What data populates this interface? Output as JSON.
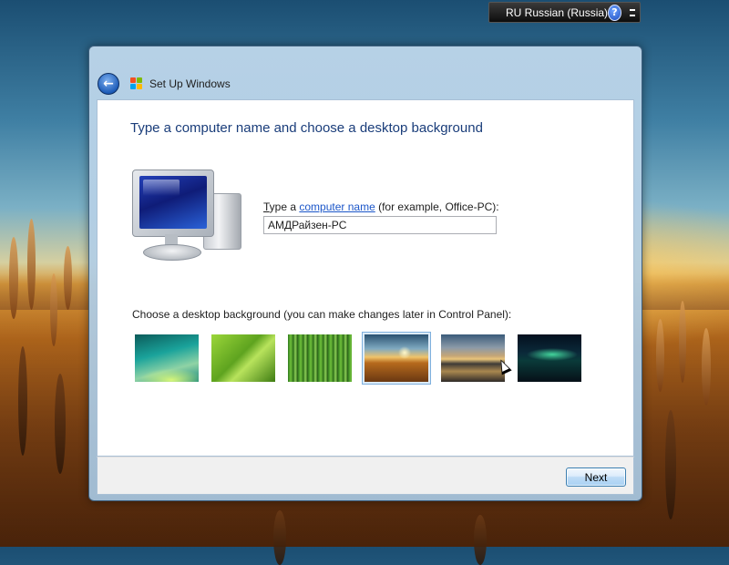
{
  "language_bar": {
    "label": "RU Russian (Russia)",
    "help_glyph": "?",
    "icons": [
      "help-icon",
      "options-icon"
    ]
  },
  "window": {
    "title": "Set Up Windows",
    "back_glyph": "←",
    "icons": [
      "back-arrow-icon",
      "windows-logo-icon",
      "computer-icon"
    ]
  },
  "content": {
    "heading": "Type a computer name and choose a desktop background",
    "name_label_prefix": "T",
    "name_label_rest": "ype a ",
    "name_label_link": "computer name",
    "name_label_suffix": " (for example, Office-PC):",
    "computer_name_value": "АМДРайзен-PC",
    "background_label": "Choose a desktop background (you can make changes later in Control Panel):",
    "backgrounds": [
      {
        "id": "aurora-green-wave",
        "selected": false
      },
      {
        "id": "green-leaf",
        "selected": false
      },
      {
        "id": "bamboo",
        "selected": false
      },
      {
        "id": "golden-sunset-grass",
        "selected": true
      },
      {
        "id": "mountain-lake",
        "selected": false
      },
      {
        "id": "northern-lights",
        "selected": false
      }
    ]
  },
  "footer": {
    "next_label": "Next"
  }
}
